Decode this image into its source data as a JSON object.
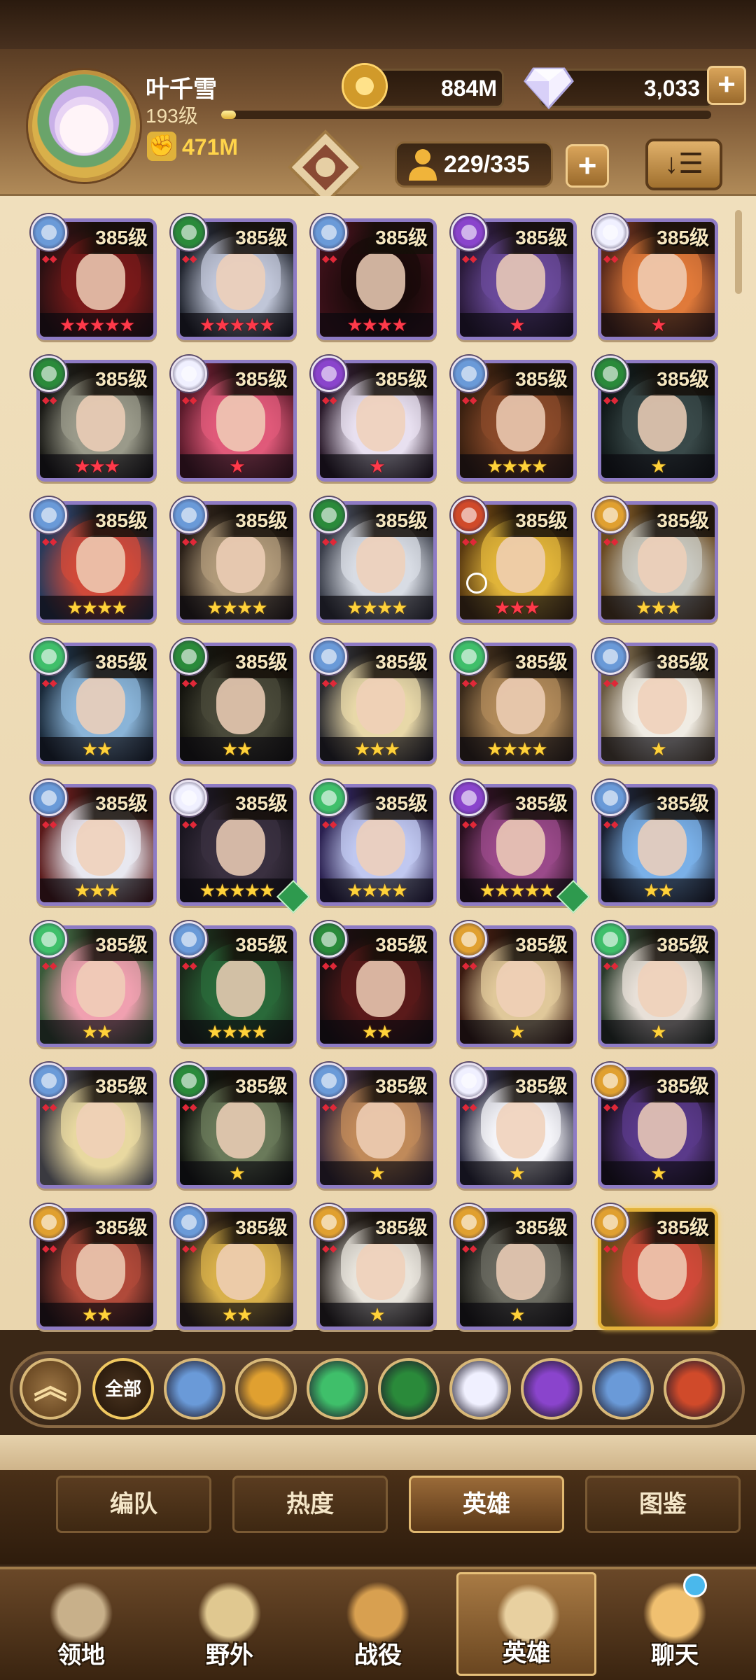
{
  "player": {
    "name": "叶千雪",
    "level": "193级",
    "xp_progress": 0.03,
    "power": "471M",
    "power_icon": "fist-icon"
  },
  "resources": {
    "gold": "884M",
    "gems": "3,033",
    "add_label": "+"
  },
  "roster": {
    "capacity": "229/335",
    "add_label": "+",
    "sort_label": "↓☰"
  },
  "colors": {
    "lightbearer": "#6a9ad8",
    "wilder": "#3fbf6a",
    "graveborn": "#2a8a3a",
    "mauler": "#e0a030",
    "celestial": "#f0f0ff",
    "hypogean": "#8a44cc",
    "dimensional": "#d04a2a",
    "star_gold": "#ffd23a",
    "star_red": "#ff3a4a"
  },
  "heroes": [
    {
      "level": "385级",
      "stars": "★★★★★",
      "star_color": "red",
      "faction": "lightbearer",
      "hue": "#7a1a1a",
      "tone": "#2a1012"
    },
    {
      "level": "385级",
      "stars": "★★★★★",
      "star_color": "red",
      "faction": "graveborn",
      "hue": "#c0c6d8",
      "tone": "#20242e"
    },
    {
      "level": "385级",
      "stars": "★★★★",
      "star_color": "red",
      "faction": "lightbearer",
      "hue": "#1a0a0a",
      "tone": "#3a1018"
    },
    {
      "level": "385级",
      "stars": "★",
      "star_color": "red",
      "faction": "hypogean",
      "hue": "#6a4a9a",
      "tone": "#2a1a3a"
    },
    {
      "level": "385级",
      "stars": "★",
      "star_color": "red",
      "faction": "celestial",
      "hue": "#e07a3a",
      "tone": "#5a2a1a"
    },
    {
      "level": "385级",
      "stars": "★★★",
      "star_color": "red",
      "faction": "graveborn",
      "hue": "#9a9a8a",
      "tone": "#1a1a16"
    },
    {
      "level": "385级",
      "stars": "★",
      "star_color": "red",
      "faction": "celestial",
      "hue": "#e05a7a",
      "tone": "#5a1a2a"
    },
    {
      "level": "385级",
      "stars": "★",
      "star_color": "red",
      "faction": "hypogean",
      "hue": "#e8e0f0",
      "tone": "#2a1a2a"
    },
    {
      "level": "385级",
      "stars": "★★★★",
      "star_color": "gold",
      "faction": "lightbearer",
      "hue": "#8a4a2a",
      "tone": "#3a2010"
    },
    {
      "level": "385级",
      "stars": "★",
      "star_color": "gold",
      "faction": "graveborn",
      "hue": "#3a4a4a",
      "tone": "#101818"
    },
    {
      "level": "385级",
      "stars": "★★★★",
      "star_color": "gold",
      "faction": "lightbearer",
      "hue": "#d04a3a",
      "tone": "#2a3a5a"
    },
    {
      "level": "385级",
      "stars": "★★★★",
      "star_color": "gold",
      "faction": "lightbearer",
      "hue": "#b09a7a",
      "tone": "#2a2018"
    },
    {
      "level": "385级",
      "stars": "★★★★",
      "star_color": "gold",
      "faction": "graveborn",
      "hue": "#d8dce4",
      "tone": "#3a3e4a"
    },
    {
      "level": "385级",
      "stars": "★★★",
      "star_color": "red",
      "faction": "dimensional",
      "hue": "#e0b43a",
      "tone": "#5a3a10",
      "timer": true
    },
    {
      "level": "385级",
      "stars": "★★★",
      "star_color": "gold",
      "faction": "mauler",
      "hue": "#c8c8c0",
      "tone": "#6a4a20"
    },
    {
      "level": "385级",
      "stars": "★★",
      "star_color": "gold",
      "faction": "wilder",
      "hue": "#8ab4d8",
      "tone": "#1a2a3a"
    },
    {
      "level": "385级",
      "stars": "★★",
      "star_color": "gold",
      "faction": "graveborn",
      "hue": "#4a4a3a",
      "tone": "#14140e"
    },
    {
      "level": "385级",
      "stars": "★★★",
      "star_color": "gold",
      "faction": "lightbearer",
      "hue": "#e8d8a8",
      "tone": "#2a2a2e"
    },
    {
      "level": "385级",
      "stars": "★★★★",
      "star_color": "gold",
      "faction": "wilder",
      "hue": "#b08a5a",
      "tone": "#3a2a1a"
    },
    {
      "level": "385级",
      "stars": "★",
      "star_color": "gold",
      "faction": "lightbearer",
      "hue": "#f0ece4",
      "tone": "#6a5a40"
    },
    {
      "level": "385级",
      "stars": "★★★",
      "star_color": "gold",
      "faction": "lightbearer",
      "hue": "#e8e8f0",
      "tone": "#5a1a1a"
    },
    {
      "level": "385级",
      "stars": "★★★★★",
      "star_color": "gold",
      "faction": "celestial",
      "hue": "#3a3040",
      "tone": "#1a1620",
      "hourglass": true
    },
    {
      "level": "385级",
      "stars": "★★★★",
      "star_color": "gold",
      "faction": "wilder",
      "hue": "#c0c8f0",
      "tone": "#2a2050"
    },
    {
      "level": "385级",
      "stars": "★★★★★",
      "star_color": "gold",
      "faction": "hypogean",
      "hue": "#9a4a8a",
      "tone": "#2a1020",
      "hourglass": true
    },
    {
      "level": "385级",
      "stars": "★★",
      "star_color": "gold",
      "faction": "lightbearer",
      "hue": "#7ab0e8",
      "tone": "#1a2030"
    },
    {
      "level": "385级",
      "stars": "★★",
      "star_color": "gold",
      "faction": "wilder",
      "hue": "#f0a0b0",
      "tone": "#3a5a3a"
    },
    {
      "level": "385级",
      "stars": "★★★★",
      "star_color": "gold",
      "faction": "lightbearer",
      "hue": "#2a6a3a",
      "tone": "#1a2a1a"
    },
    {
      "level": "385级",
      "stars": "★★",
      "star_color": "gold",
      "faction": "graveborn",
      "hue": "#5a1a1a",
      "tone": "#1a0e10"
    },
    {
      "level": "385级",
      "stars": "★",
      "star_color": "gold",
      "faction": "mauler",
      "hue": "#e0c89a",
      "tone": "#3a1a10"
    },
    {
      "level": "385级",
      "stars": "★",
      "star_color": "gold",
      "faction": "wilder",
      "hue": "#e8e0d8",
      "tone": "#2a3a2a"
    },
    {
      "level": "385级",
      "stars": "",
      "star_color": "gold",
      "faction": "lightbearer",
      "hue": "#e8d8a0",
      "tone": "#3a3a40"
    },
    {
      "level": "385级",
      "stars": "★",
      "star_color": "gold",
      "faction": "graveborn",
      "hue": "#6a7a5a",
      "tone": "#10140e"
    },
    {
      "level": "385级",
      "stars": "★",
      "star_color": "gold",
      "faction": "lightbearer",
      "hue": "#c08a5a",
      "tone": "#3a2a3a"
    },
    {
      "level": "385级",
      "stars": "★",
      "star_color": "gold",
      "faction": "celestial",
      "hue": "#f4f4f8",
      "tone": "#2a2a40"
    },
    {
      "level": "385级",
      "stars": "★",
      "star_color": "gold",
      "faction": "mauler",
      "hue": "#5a3a8a",
      "tone": "#1a1020"
    },
    {
      "level": "385级",
      "stars": "★★",
      "star_color": "gold",
      "faction": "mauler",
      "hue": "#b04a3a",
      "tone": "#2a1414"
    },
    {
      "level": "385级",
      "stars": "★★",
      "star_color": "gold",
      "faction": "lightbearer",
      "hue": "#d8b04a",
      "tone": "#3a2a1a"
    },
    {
      "level": "385级",
      "stars": "★",
      "star_color": "gold",
      "faction": "mauler",
      "hue": "#e8e4dc",
      "tone": "#2a2420"
    },
    {
      "level": "385级",
      "stars": "★",
      "star_color": "gold",
      "faction": "mauler",
      "hue": "#6a6a60",
      "tone": "#1a1a16"
    },
    {
      "level": "385级",
      "stars": "",
      "star_color": "gold",
      "faction": "mauler",
      "hue": "#d04a3a",
      "tone": "#6a4a18",
      "selected": true
    }
  ],
  "filters": {
    "up_icon": "chevron-up-icon",
    "all_label": "全部",
    "factions": [
      "lightbearer",
      "mauler",
      "wilder",
      "graveborn",
      "celestial",
      "hypogean",
      "lightbearer-alt",
      "dimensional"
    ]
  },
  "tabs": [
    "编队",
    "热度",
    "英雄",
    "图鉴"
  ],
  "active_tab": 2,
  "nav": [
    {
      "label": "领地",
      "icon": "castle-icon"
    },
    {
      "label": "野外",
      "icon": "map-scroll-icon"
    },
    {
      "label": "战役",
      "icon": "sword-shield-icon"
    },
    {
      "label": "英雄",
      "icon": "helmet-icon"
    },
    {
      "label": "聊天",
      "icon": "chat-avatar-icon"
    }
  ],
  "active_nav": 3
}
